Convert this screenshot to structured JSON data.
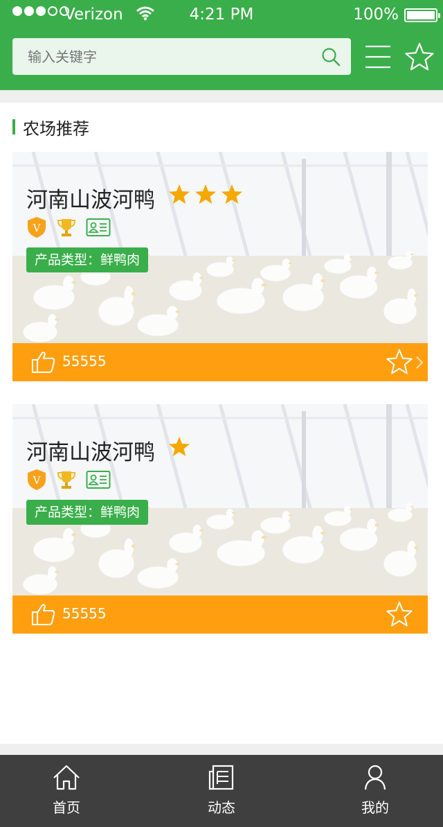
{
  "status_bar": {
    "carrier": "Verizon",
    "time": "4:21 PM",
    "battery": "100%"
  },
  "search": {
    "placeholder": "输入关键字"
  },
  "section": {
    "title": "农场推荐"
  },
  "cards": [
    {
      "name": "河南山波河鸭",
      "rating_stars": 3,
      "product_type": "产品类型：鲜鸭肉",
      "likes": "55555",
      "badges": [
        "v-shield-icon",
        "trophy-icon",
        "id-card-icon"
      ]
    },
    {
      "name": "河南山波河鸭",
      "rating_stars": 1,
      "product_type": "产品类型：鲜鸭肉",
      "likes": "55555",
      "badges": [
        "v-shield-icon",
        "trophy-icon",
        "id-card-icon"
      ]
    }
  ],
  "tabs": [
    {
      "label": "首页",
      "icon": "home-icon"
    },
    {
      "label": "动态",
      "icon": "news-icon"
    },
    {
      "label": "我的",
      "icon": "user-icon"
    }
  ],
  "colors": {
    "brand_green": "#3aae4a",
    "accent_orange": "#ff9f0f",
    "star_gold": "#f5a800",
    "tabbar_bg": "#3f3f3f"
  }
}
